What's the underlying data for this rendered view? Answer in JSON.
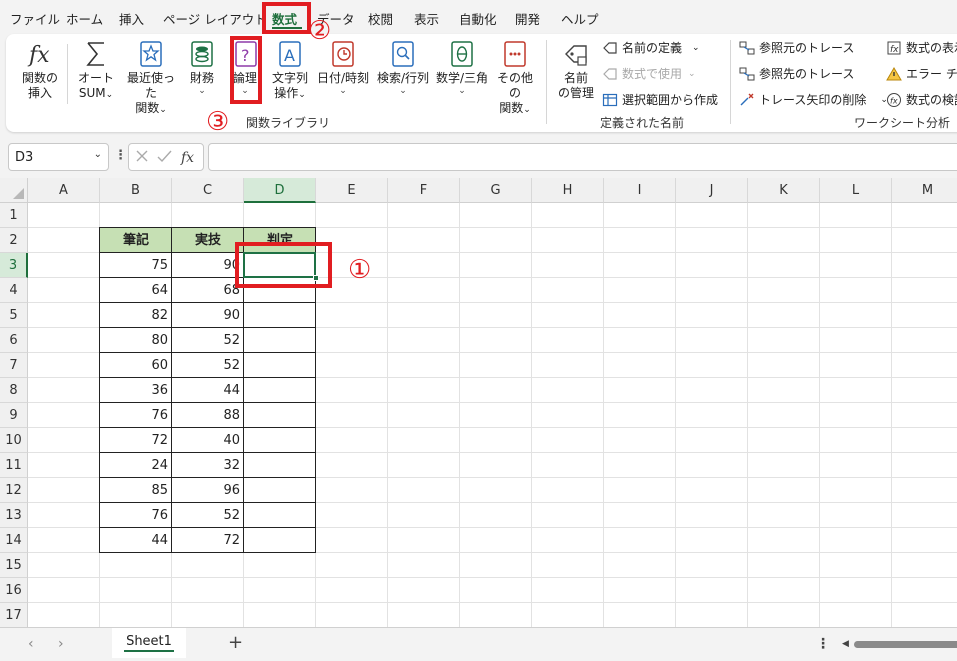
{
  "menu": {
    "tabs": [
      "ファイル",
      "ホーム",
      "挿入",
      "ページ レイアウト",
      "数式",
      "データ",
      "校閲",
      "表示",
      "自動化",
      "開発",
      "ヘルプ"
    ],
    "active": "数式"
  },
  "ribbon": {
    "function_library": {
      "label": "関数ライブラリ",
      "insert_function": [
        "関数の",
        "挿入"
      ],
      "autosum": [
        "オート",
        "SUM"
      ],
      "recent": [
        "最近使った",
        "関数"
      ],
      "financial": "財務",
      "logical": "論理",
      "text": [
        "文字列",
        "操作"
      ],
      "datetime": "日付/時刻",
      "lookup": "検索/行列",
      "math": "数学/三角",
      "more": [
        "その他の",
        "関数"
      ]
    },
    "defined_names": {
      "label": "定義された名前",
      "name_manager": [
        "名前",
        "の管理"
      ],
      "define_name": "名前の定義",
      "use_in_formula": "数式で使用",
      "create_from_selection": "選択範囲から作成"
    },
    "formula_auditing": {
      "label": "ワークシート分析",
      "trace_precedents": "参照元のトレース",
      "trace_dependents": "参照先のトレース",
      "remove_arrows": "トレース矢印の削除",
      "show_formulas": "数式の表示",
      "error_checking": "エラー チェック",
      "evaluate_formula": "数式の検証"
    }
  },
  "formula_bar": {
    "name_box": "D3",
    "fx": "fx",
    "value": ""
  },
  "sheet": {
    "columns": [
      "A",
      "B",
      "C",
      "D",
      "E",
      "F",
      "G",
      "H",
      "I",
      "J",
      "K",
      "L",
      "M"
    ],
    "rows": [
      "1",
      "2",
      "3",
      "4",
      "5",
      "6",
      "7",
      "8",
      "9",
      "10",
      "11",
      "12",
      "13",
      "14",
      "15",
      "16",
      "17"
    ],
    "selected_cell": "D3",
    "table_headers": [
      "筆記",
      "実技",
      "判定"
    ],
    "table_rows": [
      [
        "75",
        "90",
        ""
      ],
      [
        "64",
        "68",
        ""
      ],
      [
        "82",
        "90",
        ""
      ],
      [
        "80",
        "52",
        ""
      ],
      [
        "60",
        "52",
        ""
      ],
      [
        "36",
        "44",
        ""
      ],
      [
        "76",
        "88",
        ""
      ],
      [
        "72",
        "40",
        ""
      ],
      [
        "24",
        "32",
        ""
      ],
      [
        "85",
        "96",
        ""
      ],
      [
        "76",
        "52",
        ""
      ],
      [
        "44",
        "72",
        ""
      ]
    ]
  },
  "annotations": [
    "①",
    "②",
    "③"
  ],
  "sheet_tabs": {
    "active": "Sheet1",
    "add": "+"
  },
  "colors": {
    "accent": "#1e6f3c",
    "header_fill": "#c6e0b4",
    "annotation": "#e11d21"
  }
}
